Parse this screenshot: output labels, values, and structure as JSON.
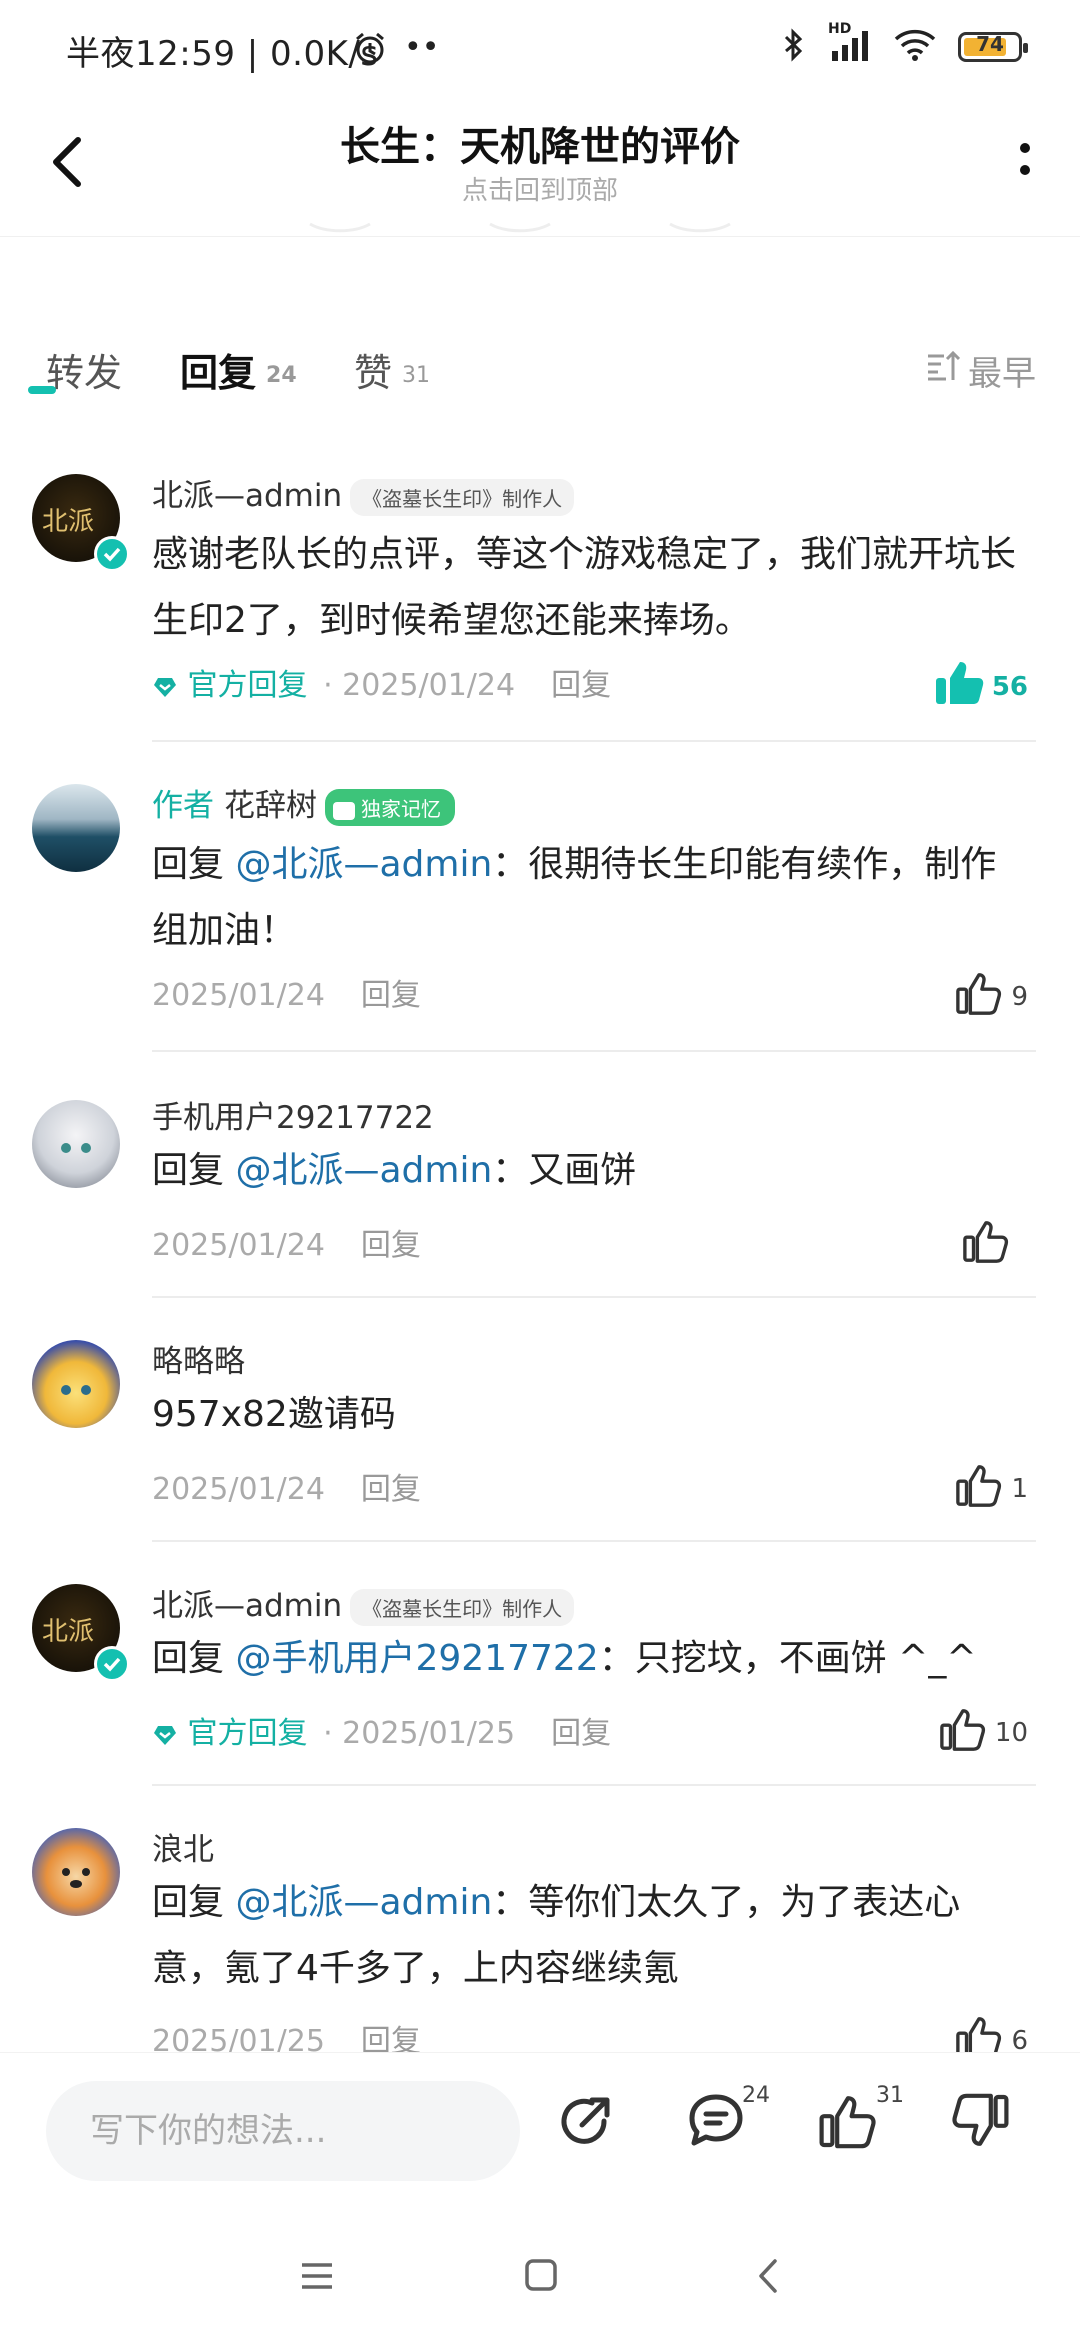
{
  "status_bar": {
    "left_text": "半夜12:59 | 0.0K/s",
    "battery": "74",
    "hd": "HD"
  },
  "header": {
    "title": "长生：天机降世的评价",
    "subtitle": "点击回到顶部"
  },
  "tabs": [
    {
      "label": "转发",
      "count": ""
    },
    {
      "label": "回复",
      "count": "24"
    },
    {
      "label": "赞",
      "count": "31"
    }
  ],
  "sort": {
    "label": "最早"
  },
  "comments": [
    {
      "name": "北派—admin",
      "maker_tag": "《盗墓长生印》制作人",
      "text": "感谢老队长的点评，等这个游戏稳定了，我们就开坑长生印2了，到时候希望您还能来捧场。",
      "official": "官方回复",
      "date": "· 2025/01/24",
      "reply": "回复",
      "likes": "56"
    },
    {
      "author_tag": "作者",
      "name": "花辞树",
      "badge": "独家记忆",
      "reply_prefix": "回复",
      "mention": "@北派—admin",
      "text": "：很期待长生印能有续作，制作组加油！",
      "date": "2025/01/24",
      "reply": "回复",
      "likes": "9"
    },
    {
      "name": "手机用户29217722",
      "reply_prefix": "回复",
      "mention": "@北派—admin",
      "text": "：又画饼",
      "date": "2025/01/24",
      "reply": "回复",
      "likes": ""
    },
    {
      "name": "略略略",
      "text": "957x82邀请码",
      "date": "2025/01/24",
      "reply": "回复",
      "likes": "1"
    },
    {
      "name": "北派—admin",
      "maker_tag": "《盗墓长生印》制作人",
      "reply_prefix": "回复",
      "mention": "@手机用户29217722",
      "text": "：只挖坟，不画饼 ^_^",
      "official": "官方回复",
      "date": "· 2025/01/25",
      "reply": "回复",
      "likes": "10"
    },
    {
      "name": "浪北",
      "reply_prefix": "回复",
      "mention": "@北派—admin",
      "text": "：等你们太久了，为了表达心意，氪了4千多了，上内容继续氪",
      "date": "2025/01/25",
      "reply": "回复",
      "likes": "6"
    }
  ],
  "bottom_bar": {
    "input_placeholder": "写下你的想法...",
    "comment_count": "24",
    "like_count": "31"
  },
  "colors": {
    "accent": "#14c0b0",
    "mention": "#1f6fa8",
    "badge_green": "#3dc47a"
  }
}
